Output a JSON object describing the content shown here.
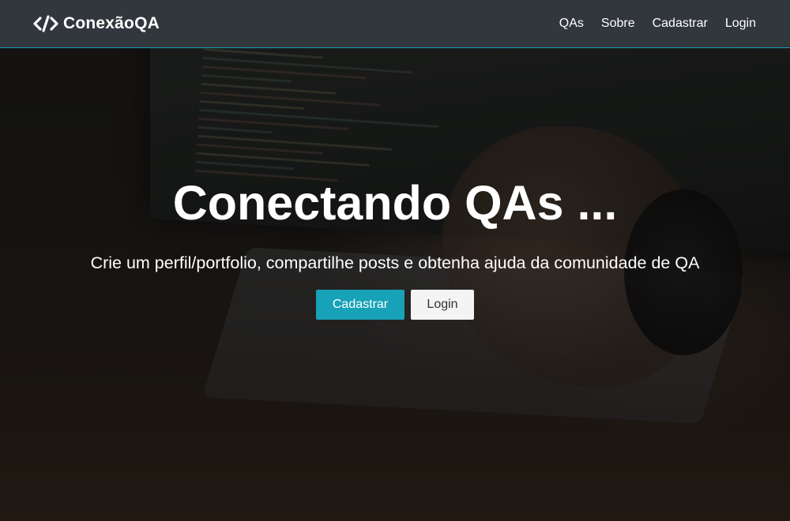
{
  "navbar": {
    "brand_icon": "code-icon",
    "brand_text": "ConexãoQA",
    "links": [
      {
        "label": "QAs"
      },
      {
        "label": "Sobre"
      },
      {
        "label": "Cadastrar"
      },
      {
        "label": "Login"
      }
    ]
  },
  "hero": {
    "title": "Conectando QAs ...",
    "lead": "Crie um perfil/portfolio, compartilhe posts e obtenha ajuda da comunidade de QA",
    "buttons": {
      "primary_label": "Cadastrar",
      "secondary_label": "Login"
    }
  },
  "colors": {
    "accent": "#17a2b8",
    "navbar": "#343a40",
    "light_button": "#f4f4f4"
  }
}
